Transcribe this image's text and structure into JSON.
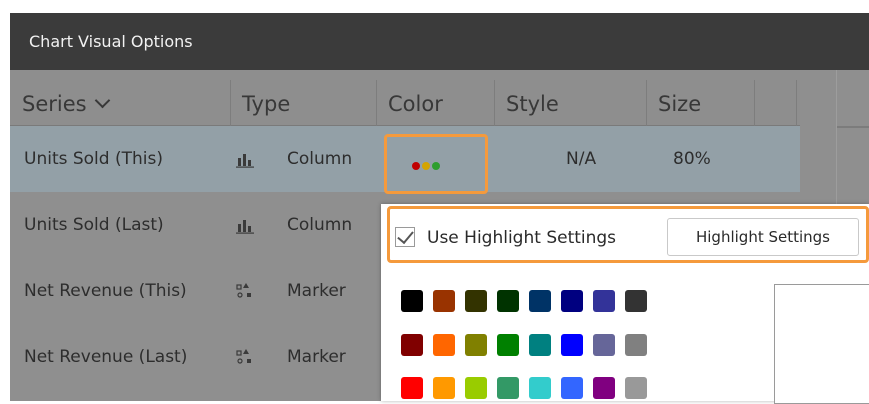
{
  "dialog": {
    "title": "Chart Visual Options",
    "columns": [
      {
        "label": "Series"
      },
      {
        "label": "Type"
      },
      {
        "label": "Color"
      },
      {
        "label": "Style"
      },
      {
        "label": "Size"
      }
    ],
    "rows": [
      {
        "series": "Units Sold (This)",
        "type_icon": "column-chart-icon",
        "type": "Column",
        "style": "N/A",
        "size": "80%",
        "colors": [
          "#c00000",
          "#d4a400",
          "#2e9e2e"
        ]
      },
      {
        "series": "Units Sold (Last)",
        "type_icon": "column-chart-icon",
        "type": "Column"
      },
      {
        "series": "Net Revenue (This)",
        "type_icon": "marker-chart-icon",
        "type": "Marker"
      },
      {
        "series": "Net Revenue (Last)",
        "type_icon": "marker-chart-icon",
        "type": "Marker"
      }
    ]
  },
  "popup": {
    "checkbox_label": "Use Highlight Settings",
    "checkbox_checked": true,
    "highlight_button_label": "Highlight Settings",
    "swatches": [
      [
        "#000000",
        "#993300",
        "#333300",
        "#003300",
        "#003366",
        "#000080",
        "#333399",
        "#333333"
      ],
      [
        "#800000",
        "#ff6600",
        "#808000",
        "#008000",
        "#008080",
        "#0000ff",
        "#666699",
        "#808080"
      ],
      [
        "#ff0000",
        "#ff9900",
        "#99cc00",
        "#339966",
        "#33cccc",
        "#3366ff",
        "#800080",
        "#999999"
      ]
    ]
  },
  "colors": {
    "highlight_outline": "#f59a3c",
    "title_bar": "#3b3b3b",
    "selected_row": "#93a0a7"
  }
}
